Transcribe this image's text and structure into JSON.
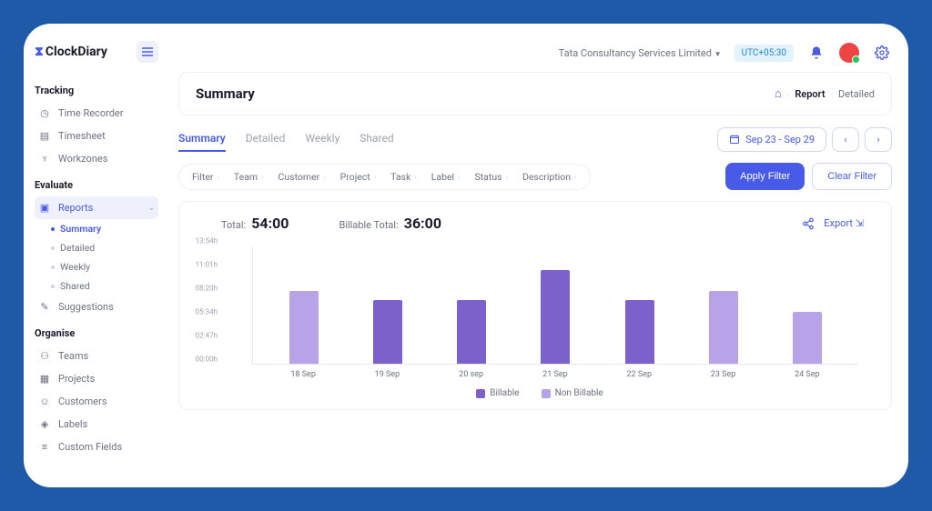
{
  "brand": {
    "name": "ClockDiary"
  },
  "topbar": {
    "company": "Tata Consultancy Services Limited",
    "timezone": "UTC+05:30"
  },
  "sidebar": {
    "sections": [
      {
        "title": "Tracking",
        "items": [
          "Time Recorder",
          "Timesheet",
          "Workzones"
        ]
      },
      {
        "title": "Evaluate",
        "items": [
          "Reports",
          "Suggestions"
        ],
        "reports_sub": [
          "Summary",
          "Detailed",
          "Weekly",
          "Shared"
        ]
      },
      {
        "title": "Organise",
        "items": [
          "Teams",
          "Projects",
          "Customers",
          "Labels",
          "Custom Fields"
        ]
      }
    ]
  },
  "page": {
    "title": "Summary",
    "breadcrumb": [
      "Report",
      "Detailed"
    ]
  },
  "tabs": [
    "Summary",
    "Detailed",
    "Weekly",
    "Shared"
  ],
  "date_range": "Sep 23 - Sep 29",
  "filters": [
    "Filter",
    "Team",
    "Customer",
    "Project",
    "Task",
    "Label",
    "Status",
    "Description"
  ],
  "buttons": {
    "apply": "Apply Filter",
    "clear": "Clear Filter",
    "export": "Export"
  },
  "stats": {
    "total_label": "Total:",
    "total_value": "54:00",
    "billable_label": "Billable Total:",
    "billable_value": "36:00"
  },
  "chart_data": {
    "type": "bar",
    "ylabel": "hours",
    "ylim": [
      0,
      13.9
    ],
    "y_ticks": [
      "13:54h",
      "11:01h",
      "08:20h",
      "05:34h",
      "02:47h",
      "00:00h"
    ],
    "categories": [
      "18 Sep",
      "19 Sep",
      "20 sep",
      "21 Sep",
      "22 Sep",
      "23 Sep",
      "24 Sep"
    ],
    "series": [
      {
        "name": "Billable",
        "type": "bill",
        "indices": [
          1,
          2,
          3,
          4
        ]
      },
      {
        "name": "Non Billable",
        "type": "nonbill",
        "indices": [
          0,
          5,
          6
        ]
      }
    ],
    "values": [
      8.6,
      7.5,
      7.5,
      11.1,
      7.5,
      8.6,
      6.1
    ]
  }
}
